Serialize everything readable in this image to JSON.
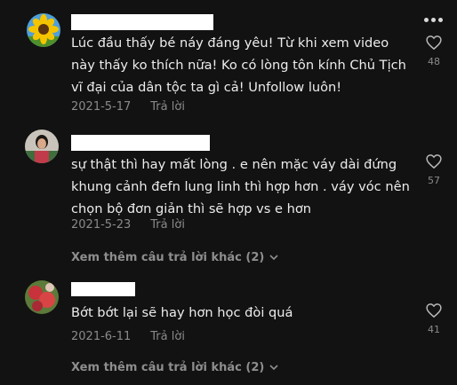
{
  "comments": [
    {
      "text": "Lúc đầu thấy bé náy đáng yêu! Từ khi xem video này thấy ko thích nữa! Ko có lòng tôn kính Chủ Tịch vĩ đại của dân tộc ta gì cả! Unfollow luôn!",
      "date": "2021-5-17",
      "reply_label": "Trả lời",
      "likes": "48",
      "avatar_icon": "sunflower-avatar"
    },
    {
      "text": "sự thật thì hay mất lòng . e nên mặc váy dài đứng khung cảnh đefn lung linh thì hợp hơn . váy vóc nên chọn bộ đơn giản thì sẽ hợp vs e hơn",
      "date": "2021-5-23",
      "reply_label": "Trả lời",
      "likes": "57",
      "avatar_icon": "person-avatar",
      "more_replies": "Xem thêm câu trả lời khác (2)"
    },
    {
      "text": "Bớt bớt lại sẽ hay hơn học đòi quá",
      "date": "2021-6-11",
      "reply_label": "Trả lời",
      "likes": "41",
      "avatar_icon": "flower-avatar",
      "more_replies": "Xem thêm câu trả lời khác (2)"
    }
  ],
  "icons": {
    "more_options": "more-options-icon",
    "like": "heart-outline-icon",
    "expand": "chevron-down-icon"
  },
  "colors": {
    "background": "#121212",
    "text": "#ececec",
    "muted": "#8a8a8a",
    "redaction": "#ffffff"
  }
}
